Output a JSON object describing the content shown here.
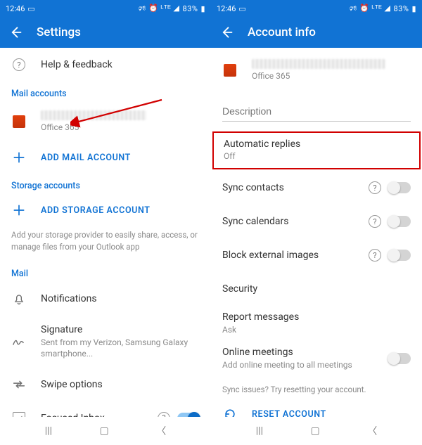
{
  "statusbar": {
    "time": "12:46",
    "battery": "83%",
    "indicators": "▮ ♪ ⏰ ᴴᴰᴱ ▲ ▌"
  },
  "left": {
    "title": "Settings",
    "help": "Help & feedback",
    "mail_accounts_label": "Mail accounts",
    "office365": "Office 365",
    "add_mail": "ADD MAIL ACCOUNT",
    "storage_accounts_label": "Storage accounts",
    "add_storage": "ADD STORAGE ACCOUNT",
    "storage_helper": "Add your storage provider to easily share, access, or manage files from your Outlook app",
    "mail_section": "Mail",
    "notifications": "Notifications",
    "signature": {
      "title": "Signature",
      "sub": "Sent from my Verizon, Samsung Galaxy smartphone..."
    },
    "swipe": "Swipe options",
    "focused": "Focused Inbox"
  },
  "right": {
    "title": "Account info",
    "office365": "Office 365",
    "desc_placeholder": "Description",
    "auto_replies": {
      "title": "Automatic replies",
      "value": "Off"
    },
    "sync_contacts": "Sync contacts",
    "sync_calendars": "Sync calendars",
    "block_images": "Block external images",
    "security": "Security",
    "report": {
      "title": "Report messages",
      "value": "Ask"
    },
    "online": {
      "title": "Online meetings",
      "sub": "Add online meeting to all meetings"
    },
    "sync_issues": "Sync issues? Try resetting your account.",
    "reset": "RESET ACCOUNT"
  },
  "colors": {
    "brand": "#1173d4",
    "highlight": "#d10000"
  }
}
